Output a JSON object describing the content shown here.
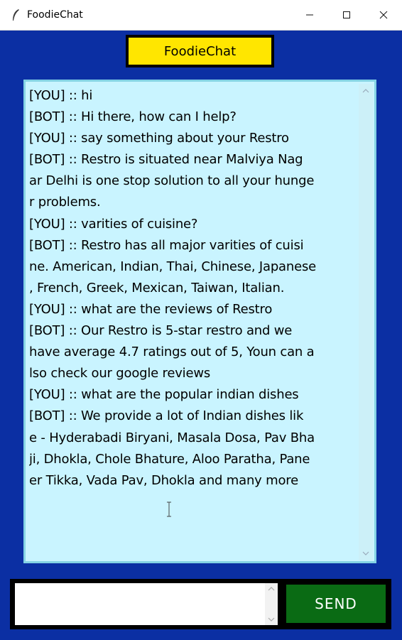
{
  "window": {
    "title": "FoodieChat",
    "controls": {
      "minimize": "—",
      "maximize": "☐",
      "close": "✕"
    }
  },
  "header": {
    "button_label": "FoodieChat"
  },
  "chat": {
    "lines": [
      "[YOU] :: hi",
      "[BOT] :: Hi there, how can I help?",
      "[YOU] :: say something about your Restro",
      "[BOT] :: Restro is situated near Malviya Nag",
      "ar Delhi is one stop solution to all your hunge",
      "r problems.",
      "[YOU] :: varities of cuisine?",
      "[BOT] :: Restro has all major varities of cuisi",
      "ne. American, Indian, Thai, Chinese, Japanese",
      ", French, Greek, Mexican, Taiwan, Italian.",
      "[YOU] :: what are the reviews of Restro",
      "[BOT] :: Our Restro is 5-star restro and we",
      "have average 4.7 ratings out of 5, Youn can a",
      "lso check our google reviews",
      "[YOU] :: what are the popular indian dishes",
      "[BOT] :: We provide a lot of Indian dishes lik",
      "e - Hyderabadi Biryani, Masala Dosa, Pav Bha",
      "ji, Dhokla, Chole Bhature, Aloo Paratha, Pane",
      "er Tikka, Vada Pav, Dhokla and many more"
    ]
  },
  "input": {
    "value": ""
  },
  "send": {
    "label": "SEND"
  },
  "colors": {
    "window_bg": "#0b2fa3",
    "header_button": "#ffe600",
    "chat_bg": "#c9f4ff",
    "send_button": "#0a6b14"
  }
}
